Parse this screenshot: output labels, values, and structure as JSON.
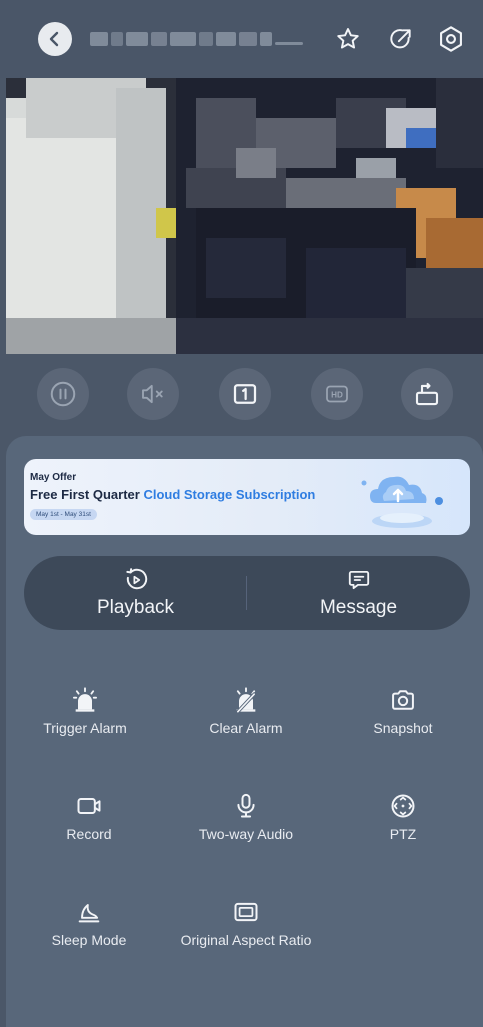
{
  "header": {
    "back_icon": "chevron-left-icon",
    "title_obscured": true,
    "actions": [
      {
        "name": "favorite",
        "icon": "star-icon"
      },
      {
        "name": "share",
        "icon": "share-icon"
      },
      {
        "name": "settings",
        "icon": "settings-hex-icon"
      }
    ]
  },
  "video": {
    "obscured": true
  },
  "controls": [
    {
      "name": "pause",
      "icon": "pause-icon"
    },
    {
      "name": "mute",
      "icon": "speaker-muted-icon"
    },
    {
      "name": "single-view",
      "icon": "one-box-icon"
    },
    {
      "name": "hd",
      "icon": "hd-icon"
    },
    {
      "name": "fullscreen-rotate",
      "icon": "rotate-screen-icon"
    }
  ],
  "banner": {
    "tag": "May Offer",
    "title_prefix": "Free First Quarter ",
    "title_highlight": "Cloud Storage Subscription",
    "date_range": "May 1st - May 31st"
  },
  "quick_actions": {
    "playback_label": "Playback",
    "message_label": "Message"
  },
  "features": [
    {
      "label": "Trigger Alarm",
      "icon": "siren-icon"
    },
    {
      "label": "Clear Alarm",
      "icon": "siren-off-icon"
    },
    {
      "label": "Snapshot",
      "icon": "camera-icon"
    },
    {
      "label": "Record",
      "icon": "video-camera-icon"
    },
    {
      "label": "Two-way Audio",
      "icon": "microphone-icon"
    },
    {
      "label": "PTZ",
      "icon": "ptz-icon"
    },
    {
      "label": "Sleep Mode",
      "icon": "moon-sleep-icon"
    },
    {
      "label": "Original Aspect Ratio",
      "icon": "aspect-ratio-icon"
    }
  ],
  "colors": {
    "background": "#4b5768",
    "panel": "#58677a",
    "pill": "#3d4959",
    "accent": "#2f7de1"
  }
}
